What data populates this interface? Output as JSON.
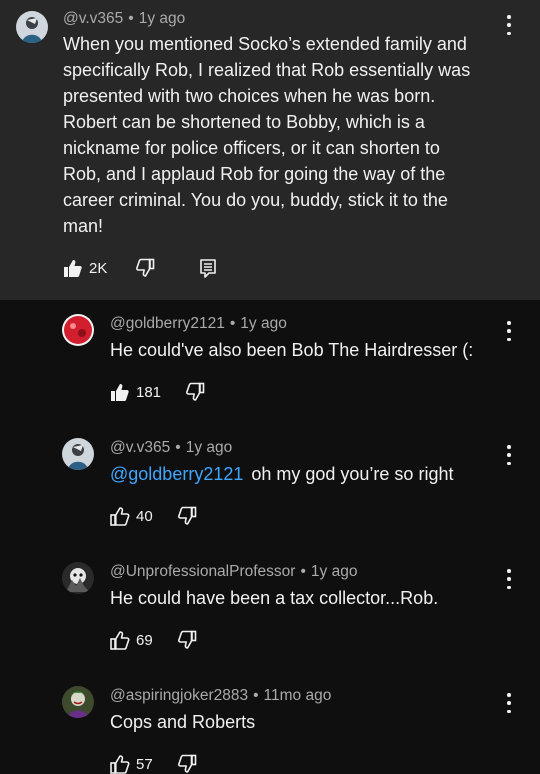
{
  "top_comment": {
    "handle": "@v.v365",
    "time": "1y ago",
    "body_lines": [
      "When you mentioned Socko’s extended family and",
      "specifically Rob, I realized that Rob essentially was",
      "presented with two choices when he was born.",
      "Robert can be shortened to Bobby, which is a",
      "nickname for police officers, or it can shorten to",
      "Rob, and I applaud Rob for going the way of the",
      "career criminal. You do you, buddy, stick it to the",
      "man!"
    ],
    "likes": "2K",
    "liked": true
  },
  "replies": [
    {
      "handle": "@goldberry2121",
      "time": "1y ago",
      "mention": "",
      "text": "He could've also been Bob The Hairdresser (:",
      "likes": "181",
      "liked": true
    },
    {
      "handle": "@v.v365",
      "time": "1y ago",
      "mention": "@goldberry2121",
      "text": "oh my god you’re so right",
      "likes": "40",
      "liked": false
    },
    {
      "handle": "@UnprofessionalProfessor",
      "time": "1y ago",
      "mention": "",
      "text": "He could have been a tax collector...Rob.",
      "likes": "69",
      "liked": false
    },
    {
      "handle": "@aspiringjoker2883",
      "time": "11mo ago",
      "mention": "",
      "text": "Cops and Roberts",
      "likes": "57",
      "liked": false
    }
  ],
  "icons": {
    "like": "thumbs-up-icon",
    "dislike": "thumbs-down-icon",
    "reply": "reply-comment-icon",
    "menu": "more-vertical-icon"
  },
  "colors": {
    "background": "#0f0f0f",
    "highlight": "#272727",
    "text": "#f1f1f1",
    "meta": "#aaaaaa",
    "mention": "#3ea6ff"
  }
}
